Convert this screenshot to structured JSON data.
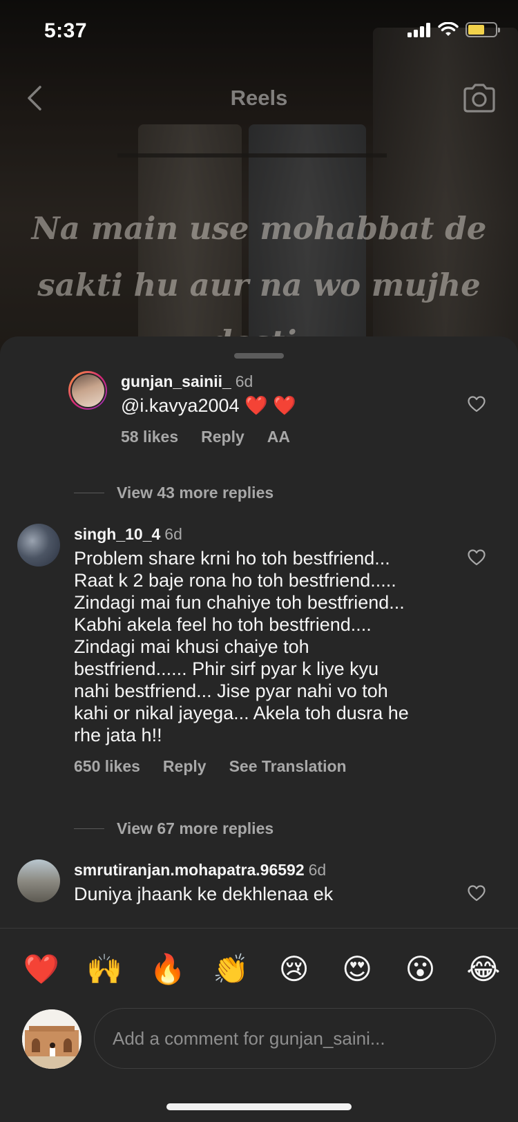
{
  "status_bar": {
    "time": "5:37",
    "battery_color": "#f2d24b"
  },
  "header": {
    "title": "Reels",
    "back_icon": "chevron-left-icon",
    "camera_icon": "camera-icon"
  },
  "reel": {
    "caption_line1": "Na main use mohabbat de",
    "caption_line2": "sakti hu aur na wo mujhe dosti,"
  },
  "comments": [
    {
      "username": "gunjan_sainii_",
      "time": "6d",
      "text": "@i.kavya2004 ❤️ ❤️",
      "likes": "58 likes",
      "reply": "Reply",
      "view_replies": "View 43 more replies"
    },
    {
      "username": "singh_10_4",
      "time": "6d",
      "text": "Problem share krni ho toh bestfriend...\nRaat k 2 baje rona ho toh bestfriend.....\nZindagi mai fun chahiye toh bestfriend...\nKabhi akela feel ho toh bestfriend....\nZindagi mai khusi chaiye toh\nbestfriend...... Phir sirf pyar k liye kyu\nnahi bestfriend... Jise pyar nahi vo toh\nkahi or nikal jayega... Akela toh dusra he\nrhe jata h!!",
      "likes": "650 likes",
      "reply": "Reply",
      "translate": "See Translation",
      "view_replies": "View 67 more replies"
    },
    {
      "username": "smrutiranjan.mohapatra.96592",
      "time": "6d",
      "text": "Duniya jhaank ke dekhlenaa ek"
    }
  ],
  "reactions": [
    "❤️",
    "🙌",
    "🔥",
    "👏",
    "😢",
    "😍",
    "😮",
    "😂"
  ],
  "composer": {
    "placeholder": "Add a comment for gunjan_saini..."
  },
  "colors": {
    "sheet_bg": "#262626",
    "secondary_text": "#a8a8a8",
    "primary_text": "#f5f5f5"
  }
}
